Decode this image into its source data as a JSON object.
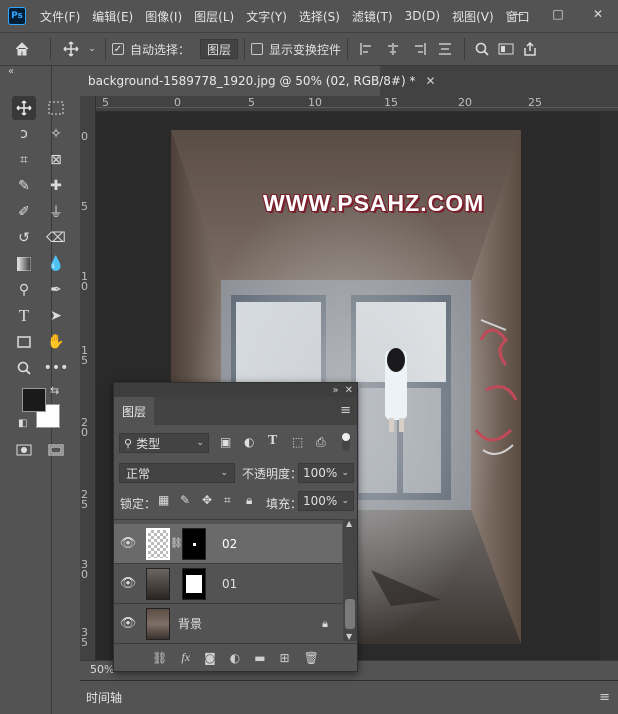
{
  "app": {
    "logo": "Ps"
  },
  "menu": [
    "文件(F)",
    "编辑(E)",
    "图像(I)",
    "图层(L)",
    "文字(Y)",
    "选择(S)",
    "滤镜(T)",
    "3D(D)",
    "视图(V)",
    "窗口"
  ],
  "window_controls": {
    "minimize": "—",
    "maximize": "□",
    "close": "✕"
  },
  "options_bar": {
    "auto_select_label": "自动选择：",
    "auto_select_checked": true,
    "auto_select_value": "图层",
    "show_transform_label": "显示变换控件"
  },
  "document": {
    "tab_title": "background-1589778_1920.jpg @ 50% (02, RGB/8#) *",
    "close": "✕",
    "watermark": "WWW.PSAHZ.COM",
    "zoom": "50%"
  },
  "rulers": {
    "h_labels": [
      "5",
      "0",
      "5",
      "10",
      "15",
      "20",
      "25"
    ],
    "v_labels": [
      "0",
      "5",
      "1\n0",
      "1\n5",
      "2\n0",
      "2\n5",
      "3\n0",
      "3\n5"
    ]
  },
  "layers_panel": {
    "tab": "图层",
    "filter_type": "类型",
    "blend_mode": "正常",
    "opacity_label": "不透明度：",
    "opacity_value": "100%",
    "lock_label": "锁定：",
    "fill_label": "填充：",
    "fill_value": "100%",
    "layers": [
      {
        "name": "02",
        "selected": true,
        "has_mask": true,
        "locked": false
      },
      {
        "name": "01",
        "selected": false,
        "has_mask": true,
        "locked": false
      },
      {
        "name": "背景",
        "selected": false,
        "has_mask": false,
        "locked": true
      }
    ]
  },
  "timeline": {
    "label": "时间轴"
  },
  "colors": {
    "foreground": "#1a1a1a",
    "background": "#ffffff",
    "accent": "#31a8ff"
  }
}
